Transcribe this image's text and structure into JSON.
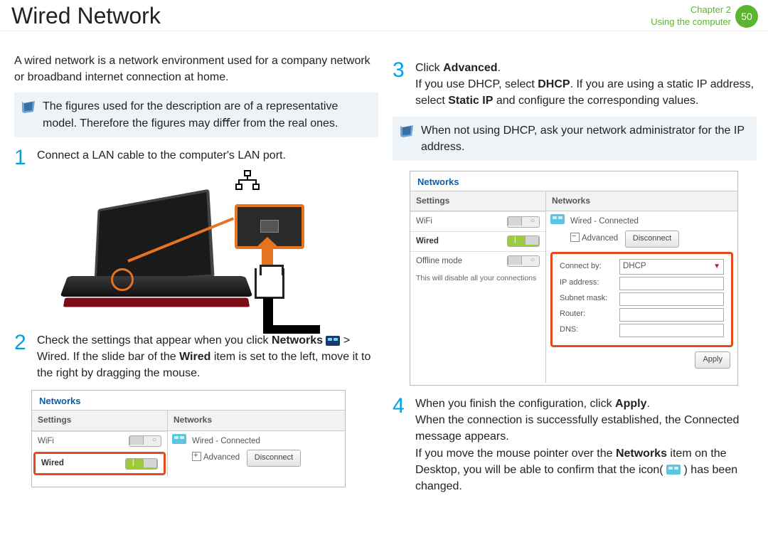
{
  "header": {
    "title": "Wired Network",
    "chapter_label": "Chapter 2",
    "subtitle": "Using the computer",
    "page_number": "50"
  },
  "left": {
    "intro": "A wired network is a network environment used for a company network or broadband internet connection at home.",
    "note": "The ﬁgures used for the description are of a representative model. Therefore the ﬁgures may diﬀer from the real ones.",
    "step1": "Connect a LAN cable to the computer's LAN port.",
    "step2_a": "Check the settings that appear when you click ",
    "step2_networks": "Networks",
    "step2_b": " > Wired. If the slide bar of the ",
    "step2_wired": "Wired",
    "step2_c": " item is set to the left, move it to the right by dragging the mouse."
  },
  "right": {
    "step3_a": "Click ",
    "step3_adv": "Advanced",
    "step3_b": ".",
    "step3_l2a": "If you use DHCP, select ",
    "step3_dhcp": "DHCP",
    "step3_l2b": ". If you are using a static IP address, select ",
    "step3_static": "Static IP",
    "step3_l2c": " and conﬁgure the corresponding values.",
    "note": "When not using DHCP, ask your network administrator for the IP address.",
    "step4_a": "When you ﬁnish the conﬁguration, click ",
    "step4_apply": "Apply",
    "step4_b": ".",
    "step4_l2": "When the connection is successfully established, the Connected message appears.",
    "step4_l3a": "If you move the mouse pointer over the ",
    "step4_net": "Networks",
    "step4_l3b": " item on the Desktop, you will be able to conﬁrm that the icon( ",
    "step4_l3c": " ) has been changed."
  },
  "shot": {
    "win_title": "Networks",
    "settings_hdr": "Settings",
    "networks_hdr": "Networks",
    "wifi": "WiFi",
    "wired": "Wired",
    "offline": "Offline mode",
    "offline_note": "This will disable all your connections",
    "wired_connected": "Wired - Connected",
    "advanced": "Advanced",
    "disconnect": "Disconnect",
    "connect_by": "Connect by:",
    "dhcp": "DHCP",
    "ip_addr": "IP address:",
    "subnet": "Subnet mask:",
    "router": "Router:",
    "dns": "DNS:",
    "apply": "Apply"
  }
}
